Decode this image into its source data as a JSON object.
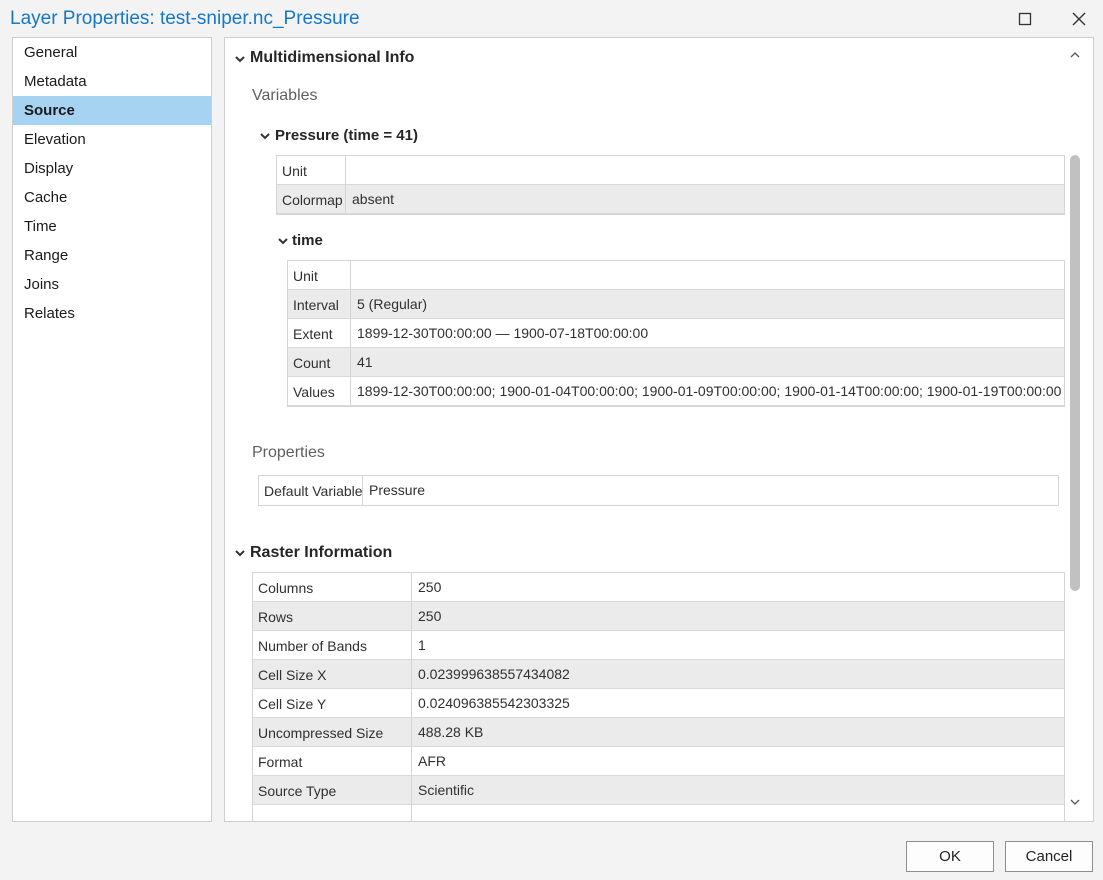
{
  "window": {
    "title": "Layer Properties: test-sniper.nc_Pressure",
    "maximize_icon": "maximize-icon",
    "close_icon": "close-icon"
  },
  "nav": {
    "items": [
      {
        "label": "General",
        "selected": false
      },
      {
        "label": "Metadata",
        "selected": false
      },
      {
        "label": "Source",
        "selected": true
      },
      {
        "label": "Elevation",
        "selected": false
      },
      {
        "label": "Display",
        "selected": false
      },
      {
        "label": "Cache",
        "selected": false
      },
      {
        "label": "Time",
        "selected": false
      },
      {
        "label": "Range",
        "selected": false
      },
      {
        "label": "Joins",
        "selected": false
      },
      {
        "label": "Relates",
        "selected": false
      }
    ]
  },
  "multidimensional": {
    "title": "Multidimensional Info",
    "variables_label": "Variables",
    "variable": {
      "title": "Pressure (time = 41)",
      "rows": [
        {
          "key": "Unit",
          "value": ""
        },
        {
          "key": "Colormap",
          "value": "absent"
        }
      ]
    },
    "dimension": {
      "title": "time",
      "rows": [
        {
          "key": "Unit",
          "value": ""
        },
        {
          "key": "Interval",
          "value": "5  (Regular)"
        },
        {
          "key": "Extent",
          "value": "1899-12-30T00:00:00 — 1900-07-18T00:00:00"
        },
        {
          "key": "Count",
          "value": "41"
        },
        {
          "key": "Values",
          "value": "1899-12-30T00:00:00; 1900-01-04T00:00:00; 1900-01-09T00:00:00; 1900-01-14T00:00:00; 1900-01-19T00:00:00"
        }
      ]
    },
    "properties_label": "Properties",
    "properties": {
      "rows": [
        {
          "key": "Default Variable",
          "value": "Pressure"
        }
      ]
    }
  },
  "raster": {
    "title": "Raster Information",
    "rows": [
      {
        "key": "Columns",
        "value": "250"
      },
      {
        "key": "Rows",
        "value": "250"
      },
      {
        "key": "Number of Bands",
        "value": "1"
      },
      {
        "key": "Cell Size X",
        "value": "0.023999638557434082"
      },
      {
        "key": "Cell Size Y",
        "value": "0.024096385542303325"
      },
      {
        "key": "Uncompressed Size",
        "value": "488.28 KB"
      },
      {
        "key": "Format",
        "value": "AFR"
      },
      {
        "key": "Source Type",
        "value": "Scientific"
      }
    ]
  },
  "buttons": {
    "ok": "OK",
    "cancel": "Cancel"
  },
  "colors": {
    "title": "#1477c8",
    "nav_selected": "#a7d3f2",
    "row_alt": "#ebebeb"
  }
}
